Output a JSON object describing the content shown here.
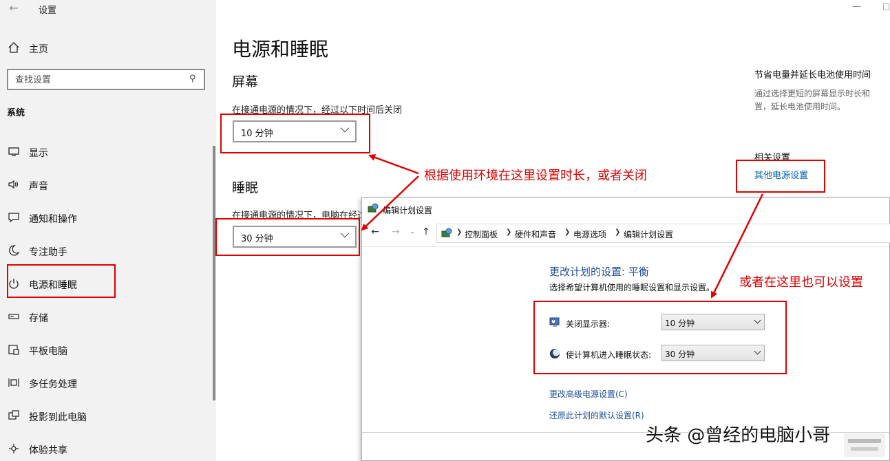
{
  "window": {
    "title": "设置",
    "back_icon": "back-arrow-icon",
    "minimize_icon": "minimize-icon",
    "maximize_icon": "maximize-icon"
  },
  "sidebar": {
    "home_label": "主页",
    "search_placeholder": "查找设置",
    "section_label": "系统",
    "items": [
      {
        "label": "显示",
        "icon": "display-icon"
      },
      {
        "label": "声音",
        "icon": "speaker-icon"
      },
      {
        "label": "通知和操作",
        "icon": "notification-icon"
      },
      {
        "label": "专注助手",
        "icon": "moon-icon"
      },
      {
        "label": "电源和睡眠",
        "icon": "power-icon"
      },
      {
        "label": "存储",
        "icon": "storage-icon"
      },
      {
        "label": "平板电脑",
        "icon": "tablet-icon"
      },
      {
        "label": "多任务处理",
        "icon": "multitask-icon"
      },
      {
        "label": "投影到此电脑",
        "icon": "project-icon"
      },
      {
        "label": "体验共享",
        "icon": "share-icon"
      }
    ]
  },
  "main": {
    "title": "电源和睡眠",
    "screen": {
      "heading": "屏幕",
      "description": "在接通电源的情况下，经过以下时间后关闭",
      "value": "10 分钟"
    },
    "sleep": {
      "heading": "睡眠",
      "description": "在接通电源的情况下，电脑在经过以下时间后进入睡眠状态",
      "value": "30 分钟"
    }
  },
  "right_panel": {
    "tip_title": "节省电量并延长电池使用时间",
    "tip_line1": "通过选择更短的屏幕显示时长和",
    "tip_line2": "置，延长电池使用时间。",
    "related_title": "相关设置",
    "other_power_link": "其他电源设置"
  },
  "annotations": {
    "first": "根据使用环境在这里设置时长，或者关闭",
    "second": "或者在这里也可以设置",
    "color": "#e00000"
  },
  "control_panel": {
    "title": "编辑计划设置",
    "breadcrumbs": [
      "控制面板",
      "硬件和声音",
      "电源选项",
      "编辑计划设置"
    ],
    "heading": "更改计划的设置: 平衡",
    "subheading": "选择希望计算机使用的睡眠设置和显示设置。",
    "display_off_label": "关闭显示器:",
    "display_off_value": "10 分钟",
    "sleep_label": "使计算机进入睡眠状态:",
    "sleep_value": "30 分钟",
    "advanced_link": "更改高级电源设置(C)",
    "restore_link": "还原此计划的默认设置(R)",
    "link_color": "#1e4e99"
  },
  "watermark": {
    "text": "头条 @曾经的电脑小哥"
  }
}
